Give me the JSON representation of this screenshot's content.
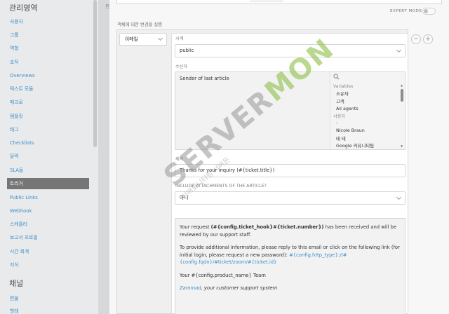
{
  "sidebar": {
    "admin_section_title": "관리영역",
    "channel_section_title": "채널",
    "items": [
      {
        "label": "사용자"
      },
      {
        "label": "그룹"
      },
      {
        "label": "역할"
      },
      {
        "label": "조직"
      },
      {
        "label": "Overviews"
      },
      {
        "label": "텍스트 모듈"
      },
      {
        "label": "매크로"
      },
      {
        "label": "템플릿"
      },
      {
        "label": "태그"
      },
      {
        "label": "Checklists"
      },
      {
        "label": "달력"
      },
      {
        "label": "SLA들"
      },
      {
        "label": "트리거",
        "active": true
      },
      {
        "label": "Public Links"
      },
      {
        "label": "Webhook"
      },
      {
        "label": "스케쥴러"
      },
      {
        "label": "보고서 프로필"
      },
      {
        "label": "시간 회계"
      },
      {
        "label": "지식"
      }
    ],
    "channel_items": [
      {
        "label": "편물"
      },
      {
        "label": "형태"
      }
    ]
  },
  "gutter_label": "트",
  "modal": {
    "expert_mode_label": "EXPERT MODE",
    "section_label": "객체에 대한 변경을 실행",
    "action_type": "이메일",
    "visibility": {
      "label": "시계",
      "value": "public"
    },
    "recipient": {
      "label": "수신자",
      "value": "Sender of last article",
      "picker": {
        "variables_header": "Variables",
        "variables": [
          "소유자",
          "고객",
          "All agents"
        ],
        "users_header": "사용자",
        "users": [
          "-",
          "Nicole Braun",
          "테 테",
          "Google 커뮤니티팀"
        ]
      }
    },
    "subject": {
      "label": "제목",
      "value": "Thanks for your inquiry (#{ticket.title})"
    },
    "attachments": {
      "label": "INCLUDE ATTACHMENTS OF THE ARTICLE?",
      "value": "아니"
    },
    "body": {
      "p1_prefix": "Your request ",
      "p1_var": "(#{config.ticket_hook}#{ticket.number})",
      "p1_suffix": " has been received and will be reviewed by our support staff.",
      "p2_text": "To provide additional information, please reply to this email or click on the following link (for initial login, please request a new password): ",
      "p2_link": "#{config.http_type}://#{config.fqdn}/#ticket/zoom/#{ticket.id}",
      "p3": "Your #{config.product_name} Team",
      "p4_link": "Zammad",
      "p4_suffix": ", your customer support system"
    },
    "remove_button": "−",
    "add_button": "+"
  },
  "watermark": {
    "text_gray": "SERVER",
    "text_green": "MON",
    "subtitle": "서버모니터링 서버몬"
  }
}
